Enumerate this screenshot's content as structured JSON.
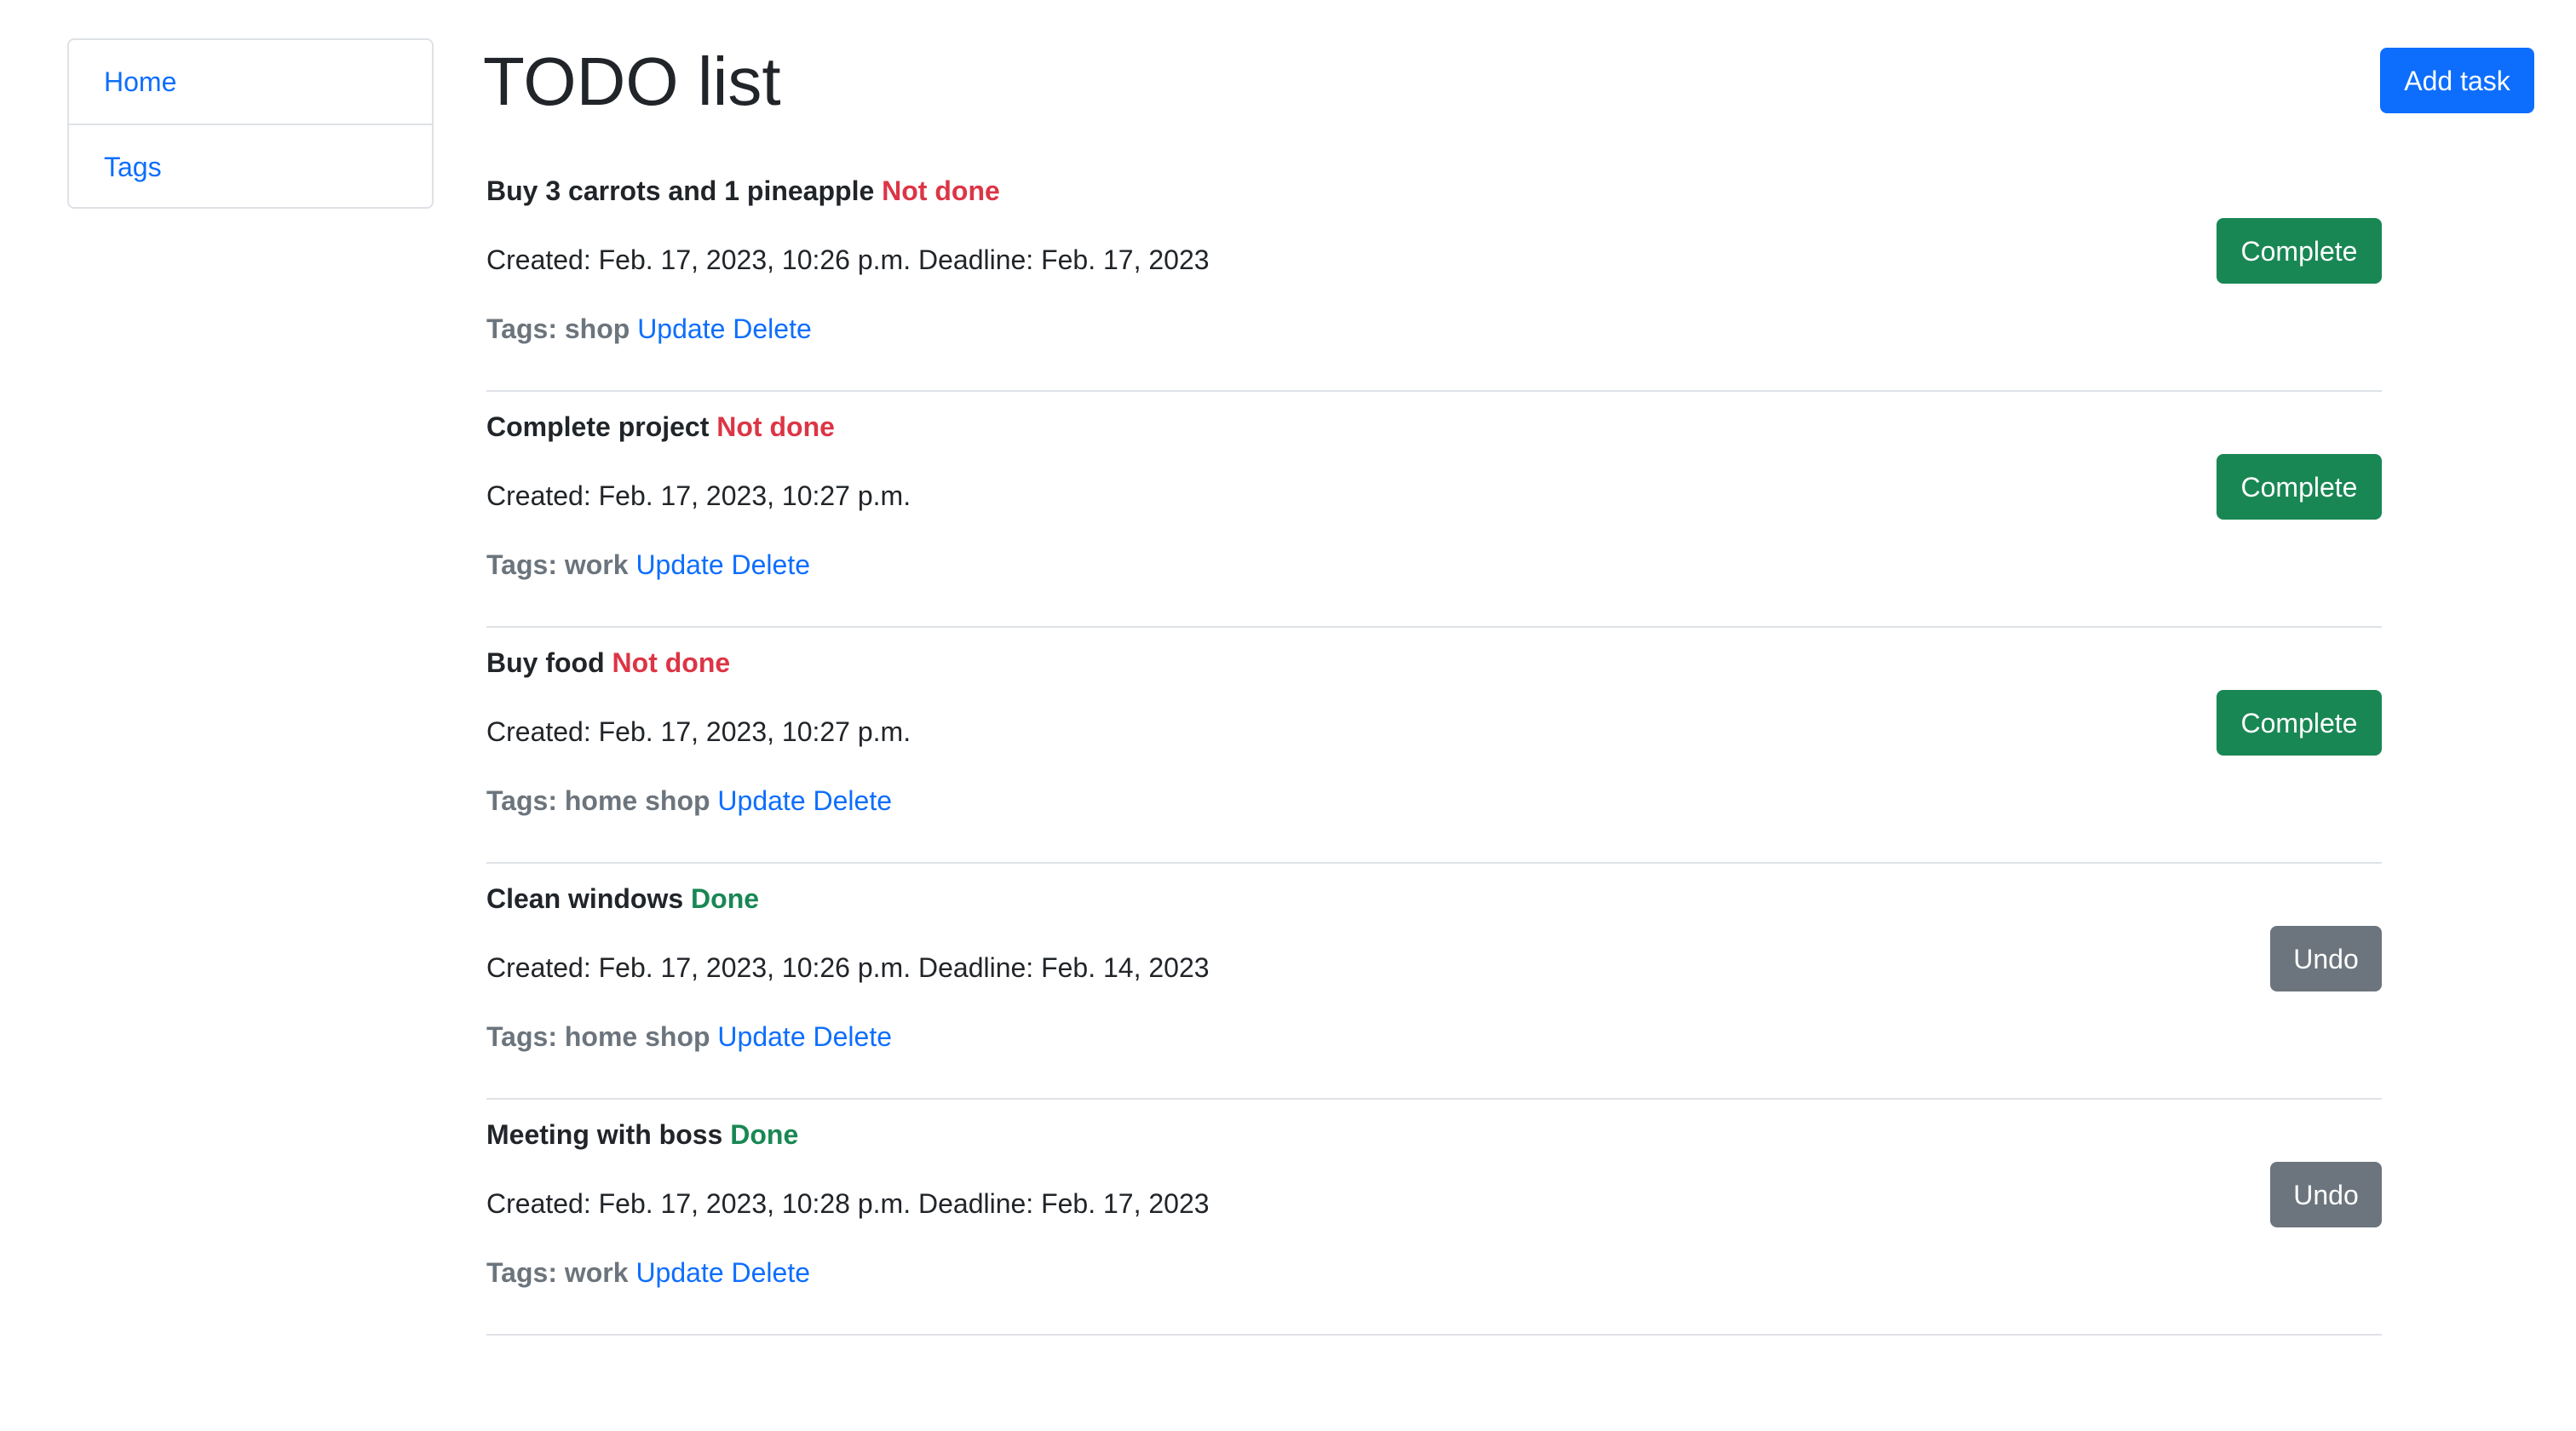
{
  "sidebar": {
    "items": [
      {
        "label": "Home"
      },
      {
        "label": "Tags"
      }
    ]
  },
  "header": {
    "title": "TODO list",
    "add_task_label": "Add task"
  },
  "tags_label": "Tags:",
  "update_label": "Update",
  "delete_label": "Delete",
  "colors": {
    "primary": "#0d6efd",
    "success": "#198754",
    "danger": "#dc3545",
    "secondary": "#6c757d"
  },
  "tasks": [
    {
      "title": "Buy 3 carrots and 1 pineapple",
      "status": "Not done",
      "dates": "Created: Feb. 17, 2023, 10:26 p.m. Deadline: Feb. 17, 2023",
      "tags": "shop",
      "action": "Complete"
    },
    {
      "title": "Complete project",
      "status": "Not done",
      "dates": "Created: Feb. 17, 2023, 10:27 p.m.",
      "tags": "work",
      "action": "Complete"
    },
    {
      "title": "Buy food",
      "status": "Not done",
      "dates": "Created: Feb. 17, 2023, 10:27 p.m.",
      "tags": "home shop",
      "action": "Complete"
    },
    {
      "title": "Clean windows",
      "status": "Done",
      "dates": "Created: Feb. 17, 2023, 10:26 p.m. Deadline: Feb. 14, 2023",
      "tags": "home shop",
      "action": "Undo"
    },
    {
      "title": "Meeting with boss",
      "status": "Done",
      "dates": "Created: Feb. 17, 2023, 10:28 p.m. Deadline: Feb. 17, 2023",
      "tags": "work",
      "action": "Undo"
    }
  ]
}
